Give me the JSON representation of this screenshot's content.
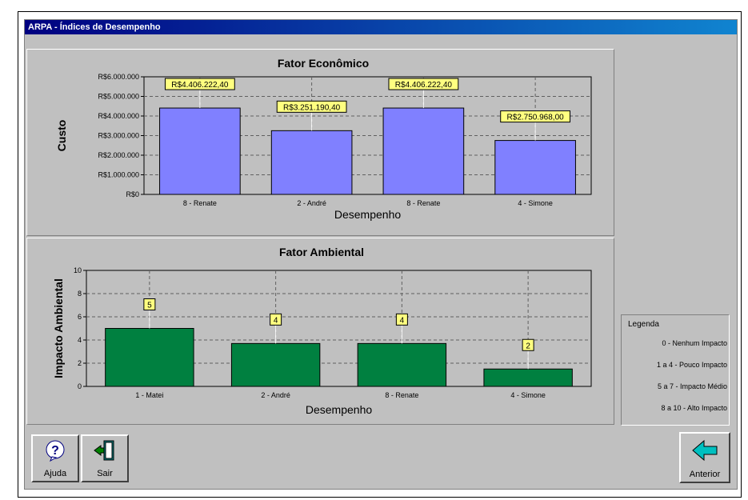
{
  "window": {
    "title": "ARPA - Índices de Desempenho"
  },
  "chart_data": [
    {
      "type": "bar",
      "title": "Fator Econômico",
      "xlabel": "Desempenho",
      "ylabel": "Custo",
      "categories": [
        "8 - Renate",
        "2 - André",
        "8 - Renate",
        "4 - Simone"
      ],
      "values": [
        4406222.4,
        3251190.4,
        4406222.4,
        2750968.0
      ],
      "data_labels": [
        "R$4.406.222,40",
        "R$3.251.190,40",
        "R$4.406.222,40",
        "R$2.750.968,00"
      ],
      "ylim": [
        0,
        6000000
      ],
      "yticks": [
        "R$0",
        "R$1.000.000",
        "R$2.000.000",
        "R$3.000.000",
        "R$4.000.000",
        "R$5.000.000",
        "R$6.000.000"
      ],
      "grid": true,
      "bar_color": "#8080ff"
    },
    {
      "type": "bar",
      "title": "Fator Ambiental",
      "xlabel": "Desempenho",
      "ylabel": "Impacto Ambiental",
      "categories": [
        "1 - Matei",
        "2 - André",
        "8 - Renate",
        "4 - Simone"
      ],
      "values": [
        5,
        3.7,
        3.7,
        1.5
      ],
      "data_labels": [
        "5",
        "4",
        "4",
        "2"
      ],
      "ylim": [
        0,
        10
      ],
      "yticks": [
        "0",
        "2",
        "4",
        "6",
        "8",
        "10"
      ],
      "grid": true,
      "bar_color": "#008040"
    }
  ],
  "legend": {
    "title": "Legenda",
    "items": [
      "0 - Nenhum Impacto",
      "1 a 4 - Pouco Impacto",
      "5 a 7 - Impacto Médio",
      "8 a 10 - Alto Impacto"
    ]
  },
  "buttons": {
    "help": "Ajuda",
    "exit": "Sair",
    "previous": "Anterior"
  },
  "icons": {
    "help": "help-question-icon",
    "exit": "exit-door-icon",
    "previous": "arrow-left-icon"
  }
}
